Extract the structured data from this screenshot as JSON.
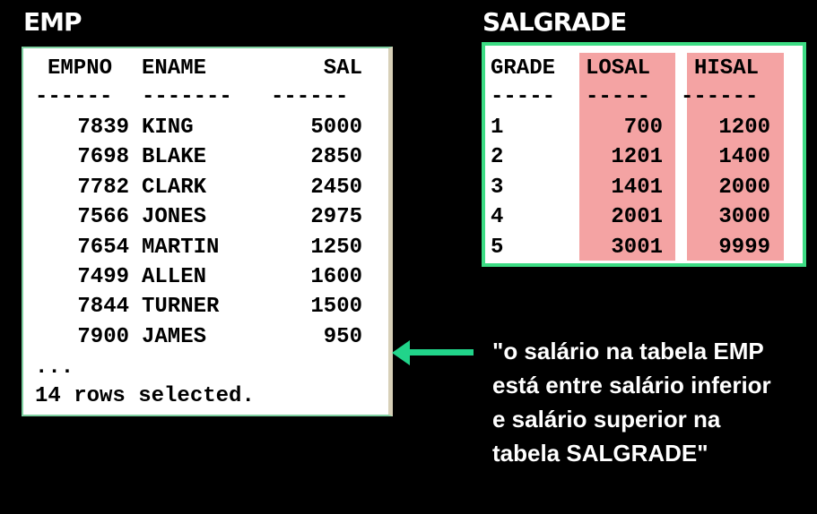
{
  "emp": {
    "title": "EMP",
    "headers": [
      "EMPNO",
      "ENAME",
      "SAL"
    ],
    "dashes": [
      "------",
      "-------",
      "------"
    ],
    "rows": [
      [
        "7839",
        "KING",
        "5000"
      ],
      [
        "7698",
        "BLAKE",
        "2850"
      ],
      [
        "7782",
        "CLARK",
        "2450"
      ],
      [
        "7566",
        "JONES",
        "2975"
      ],
      [
        "7654",
        "MARTIN",
        "1250"
      ],
      [
        "7499",
        "ALLEN",
        "1600"
      ],
      [
        "7844",
        "TURNER",
        "1500"
      ],
      [
        "7900",
        "JAMES",
        "950"
      ]
    ],
    "ellipsis": "...",
    "footer": "14 rows selected."
  },
  "salgrade": {
    "title": "SALGRADE",
    "headers": [
      "GRADE",
      "LOSAL",
      "HISAL"
    ],
    "dashes": [
      "-----",
      "-----",
      "------"
    ],
    "rows": [
      [
        "1",
        "700",
        "1200"
      ],
      [
        "2",
        "1201",
        "1400"
      ],
      [
        "3",
        "1401",
        "2000"
      ],
      [
        "4",
        "2001",
        "3000"
      ],
      [
        "5",
        "3001",
        "9999"
      ]
    ]
  },
  "caption": {
    "lines": [
      "\"o salário na tabela EMP",
      "está entre salário inferior",
      "e salário superior na",
      "tabela SALGRADE\""
    ]
  },
  "colors": {
    "background": "#000000",
    "emp_border": "#7ecfa0",
    "salgrade_border": "#3ddc84",
    "highlight": "#f4a3a3",
    "arrow": "#21d48a"
  }
}
